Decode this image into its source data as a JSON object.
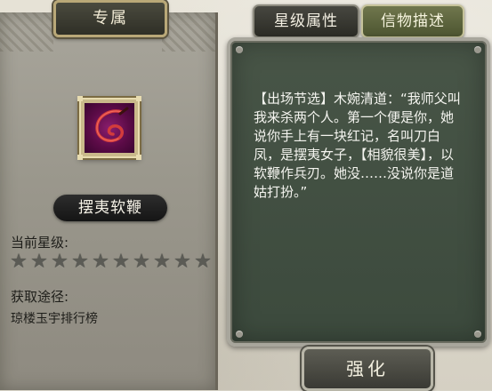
{
  "left_panel": {
    "tab_label": "专属",
    "item_name": "摆夷软鞭",
    "item_icon": "whip-icon",
    "star_label": "当前星级:",
    "stars": {
      "current": 0,
      "total": 10
    },
    "source_label": "获取途径:",
    "source_value": "琼楼玉宇排行榜"
  },
  "tabs": {
    "star_attributes": "星级属性",
    "item_description": "信物描述"
  },
  "description": {
    "text": "【出场节选】木婉清道：“我师父叫我来杀两个人。第一个便是你，她说你手上有一块红记，名叫刀白凤，是摆夷女子，【相貌很美】，以软鞭作兵刃。她没……没说你是道姑打扮。”"
  },
  "actions": {
    "strengthen": "强化"
  },
  "colors": {
    "board": "#485547",
    "active_tab": "#70774d",
    "item_bg": "#5c0b47"
  }
}
